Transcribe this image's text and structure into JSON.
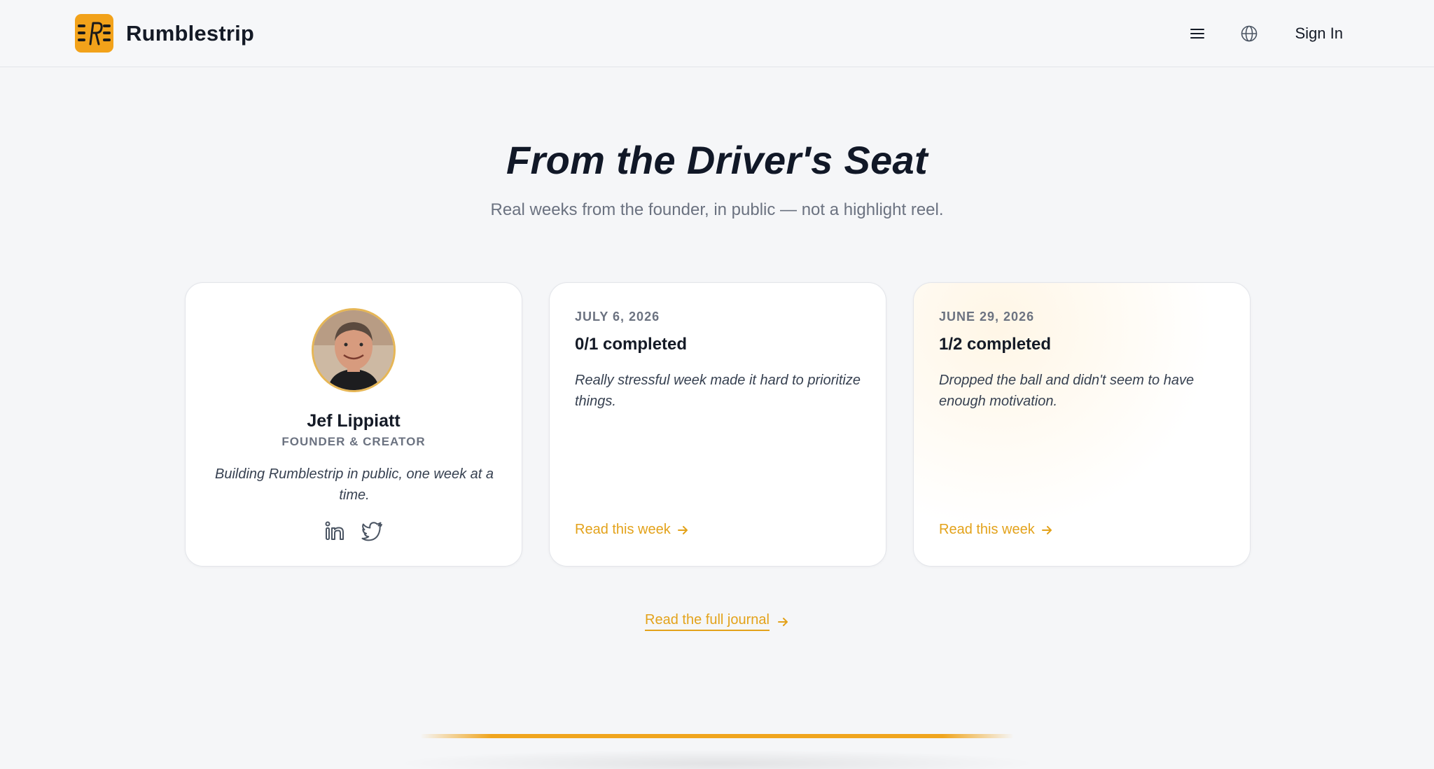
{
  "header": {
    "brand_name": "Rumblestrip",
    "logo_icon": "rumblestrip-logo-icon",
    "menu_icon": "menu-icon",
    "language_icon": "globe-icon",
    "sign_in_label": "Sign In"
  },
  "hero": {
    "title": "From the Driver's Seat",
    "subtitle": "Real weeks from the founder, in public — not a highlight reel."
  },
  "profile": {
    "name": "Jef Lippiatt",
    "role": "FOUNDER & CREATOR",
    "bio": "Building Rumblestrip in public, one week at a time.",
    "socials": [
      "linkedin-icon",
      "twitter-icon"
    ]
  },
  "weeks": [
    {
      "date": "JULY 6, 2026",
      "title": "0/1 completed",
      "body": "Really stressful week made it hard to prioritize things.",
      "link_label": "Read this week"
    },
    {
      "date": "JUNE 29, 2026",
      "title": "1/2 completed",
      "body": "Dropped the ball and didn't seem to have enough motivation.",
      "link_label": "Read this week"
    }
  ],
  "journal_link_label": "Read the full journal",
  "colors": {
    "accent": "#e3a21a",
    "logo_bg": "#f2a21a",
    "text_primary": "#141a26",
    "text_muted": "#6b7280",
    "page_bg": "#f5f6f8"
  }
}
